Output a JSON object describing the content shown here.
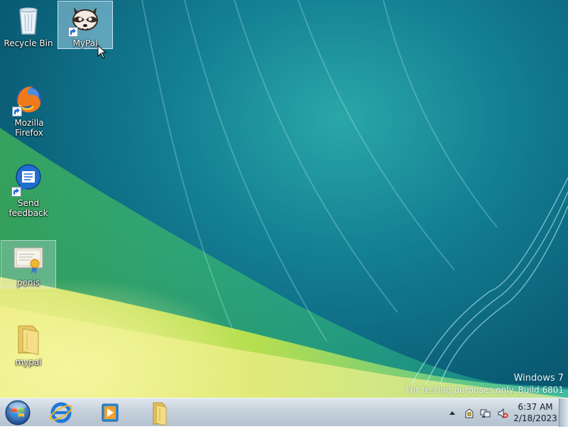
{
  "desktop": {
    "icons": [
      {
        "name": "recycle-bin",
        "label": "Recycle Bin",
        "icon": "recycle-bin-icon"
      },
      {
        "name": "mypal-shortcut",
        "label": "MyPal",
        "icon": "raccoon-icon"
      },
      {
        "name": "firefox-shortcut",
        "label": "Mozilla Firefox",
        "icon": "firefox-icon"
      },
      {
        "name": "send-feedback-shortcut",
        "label": "Send\nfeedback",
        "label_line1": "Send",
        "label_line2": "feedback",
        "icon": "feedback-icon"
      },
      {
        "name": "certificate-file",
        "label": "penis",
        "icon": "certificate-icon"
      },
      {
        "name": "mypal-folder",
        "label": "mypal",
        "icon": "folder-icon"
      }
    ],
    "watermark": {
      "os": "Windows  7",
      "build": "For testing purposes only. Build 6801"
    }
  },
  "taskbar": {
    "start": {
      "icon": "windows-orb-icon"
    },
    "pinned": [
      {
        "name": "internet-explorer",
        "icon": "internet-explorer-icon"
      },
      {
        "name": "media-player",
        "icon": "media-player-icon"
      },
      {
        "name": "file-explorer",
        "icon": "folder-icon"
      }
    ],
    "tray": {
      "icons": [
        "show-hidden-icons-arrow",
        "action-center-icon",
        "network-icon",
        "volume-muted-icon"
      ]
    },
    "clock": {
      "time": "6:37 AM",
      "date": "2/18/2023"
    }
  },
  "colors": {
    "taskbar_bg": "#c6d1dc",
    "selection": "#bee6fa",
    "wallpaper_accent": "#9fe03c"
  }
}
